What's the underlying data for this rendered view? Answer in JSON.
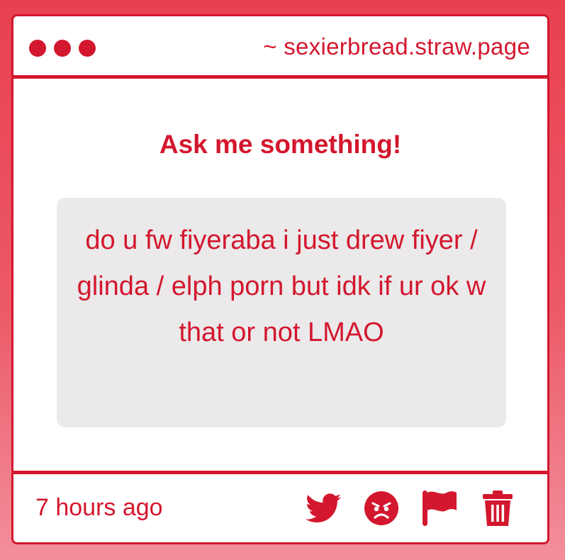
{
  "window": {
    "url": "~ sexierbread.straw.page",
    "dot_color": "#d3172e"
  },
  "question": {
    "prompt": "Ask me something!",
    "text": "do u fw fiyeraba i just drew fiyer / glinda / elph porn but idk if ur ok w that or not LMAO"
  },
  "footer": {
    "timestamp": "7 hours ago",
    "actions": [
      {
        "icon": "twitter-icon"
      },
      {
        "icon": "angry-face-icon"
      },
      {
        "icon": "flag-icon"
      },
      {
        "icon": "trash-icon"
      }
    ]
  },
  "colors": {
    "accent": "#d3172e",
    "question_bg": "#ebe9ea",
    "card_bg": "#ffffff"
  }
}
